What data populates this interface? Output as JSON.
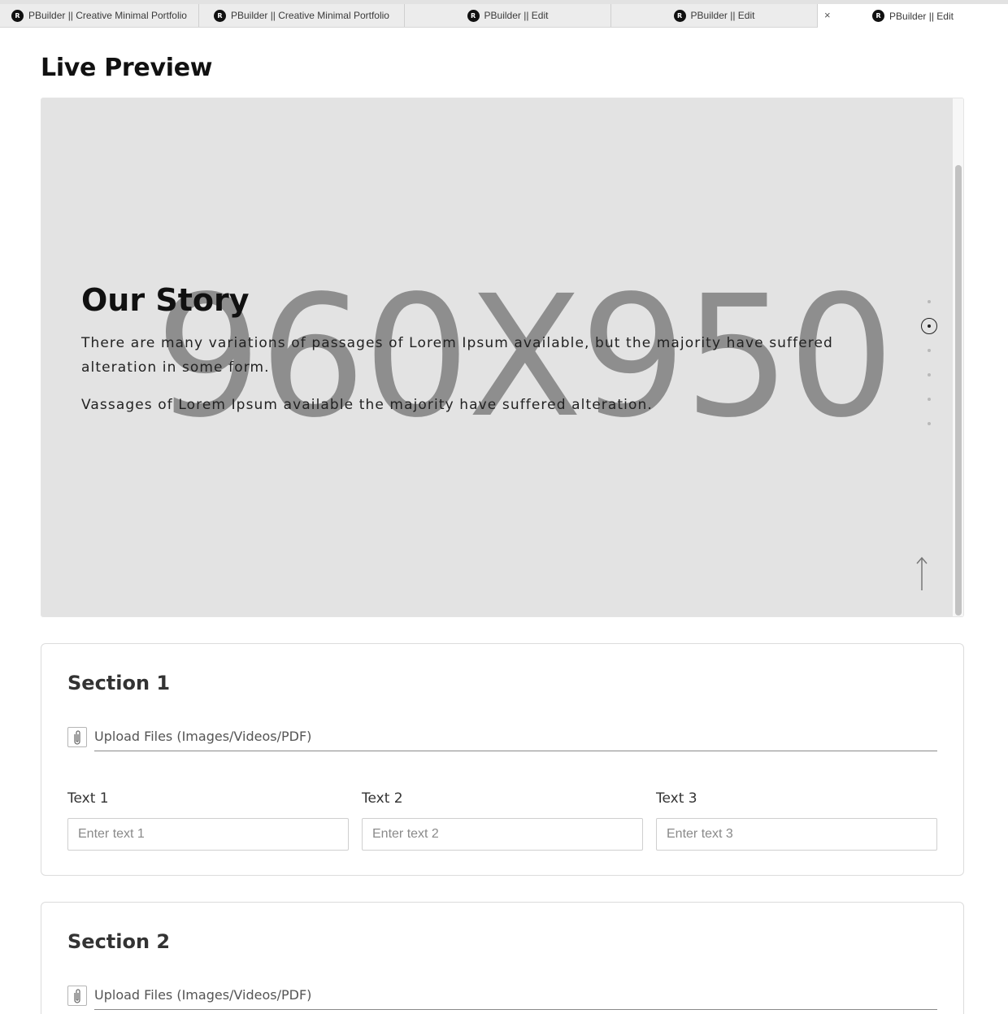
{
  "tabs": [
    {
      "label": "PBuilder || Creative Minimal Portfolio",
      "favicon": "R"
    },
    {
      "label": "PBuilder || Creative Minimal Portfolio",
      "favicon": "R"
    },
    {
      "label": "PBuilder || Edit",
      "favicon": "R"
    },
    {
      "label": "PBuilder || Edit",
      "favicon": "R"
    },
    {
      "label": "PBuilder || Edit",
      "favicon": "R",
      "active": true,
      "close": "×"
    }
  ],
  "live_preview": {
    "heading": "Live Preview",
    "placeholder_text": "960X950",
    "story": {
      "title": "Our Story",
      "paragraph1": "There are many variations of passages of Lorem Ipsum available, but the majority have suffered alteration in some form.",
      "paragraph2": "Vassages of Lorem Ipsum available the majority have suffered alteration."
    },
    "nav_dots": {
      "count": 6,
      "active_index": 1
    },
    "icons": {
      "scroll_top": "arrow-up-icon",
      "active_dot": "target-dot-icon"
    }
  },
  "sections": [
    {
      "title": "Section 1",
      "upload_label": "Upload Files (Images/Videos/PDF)",
      "fields": [
        {
          "label": "Text 1",
          "placeholder": "Enter text 1",
          "value": ""
        },
        {
          "label": "Text 2",
          "placeholder": "Enter text 2",
          "value": ""
        },
        {
          "label": "Text 3",
          "placeholder": "Enter text 3",
          "value": ""
        }
      ]
    },
    {
      "title": "Section 2",
      "upload_label": "Upload Files (Images/Videos/PDF)"
    }
  ],
  "colors": {
    "preview_bg": "#e3e3e3",
    "placeholder_text": "#8e8e8e",
    "heading": "#111111"
  }
}
